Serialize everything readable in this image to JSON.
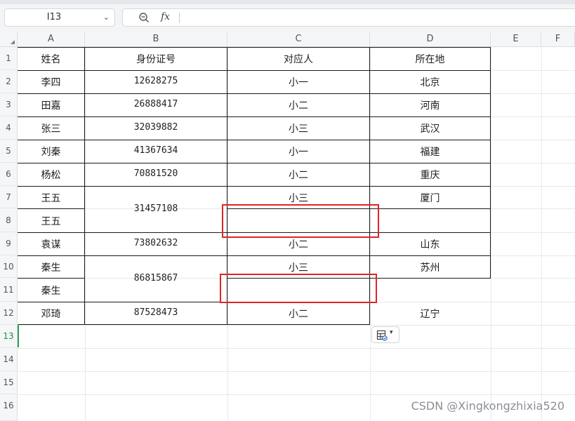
{
  "formula_bar": {
    "name_box": "I13",
    "fx_label": "fx",
    "formula": ""
  },
  "columns": [
    "A",
    "B",
    "C",
    "D",
    "E",
    "F"
  ],
  "rows": [
    "1",
    "2",
    "3",
    "4",
    "5",
    "6",
    "7",
    "8",
    "9",
    "10",
    "11",
    "12",
    "13",
    "14",
    "15",
    "16"
  ],
  "selected_row": "13",
  "table": {
    "headers": [
      "姓名",
      "身份证号",
      "对应人",
      "所在地"
    ],
    "rows": [
      {
        "name": "李四",
        "id": "12628275",
        "person": "小一",
        "place": "北京"
      },
      {
        "name": "田嘉",
        "id": "26888417",
        "person": "小二",
        "place": "河南"
      },
      {
        "name": "张三",
        "id": "32039882",
        "person": "小三",
        "place": "武汉"
      },
      {
        "name": "刘秦",
        "id": "41367634",
        "person": "小一",
        "place": "福建"
      },
      {
        "name": "杨松",
        "id": "70881520",
        "person": "小二",
        "place": "重庆"
      },
      {
        "name": "王五",
        "id": "31457108",
        "person": "小三",
        "place": "厦门"
      },
      {
        "name": "王五",
        "id": "",
        "person": "",
        "place": ""
      },
      {
        "name": "袁谋",
        "id": "73802632",
        "person": "小二",
        "place": "山东"
      },
      {
        "name": "秦生",
        "id": "86815867",
        "person": "小三",
        "place": "苏州"
      },
      {
        "name": "秦生",
        "id": "",
        "person": "",
        "place": ""
      },
      {
        "name": "邓琦",
        "id": "87528473",
        "person": "小二",
        "place": "辽宁"
      }
    ]
  },
  "icons": {
    "zoom": "zoom-out-magnifier-icon",
    "name_box_chevron": "chevron-down-icon",
    "paste_options": "paste-options-icon",
    "corner": "select-all-triangle-icon"
  },
  "colors": {
    "highlight_box": "#e02424",
    "selected_row_marker": "#2e9e5b"
  },
  "watermark": "CSDN @Xingkongzhixia520"
}
